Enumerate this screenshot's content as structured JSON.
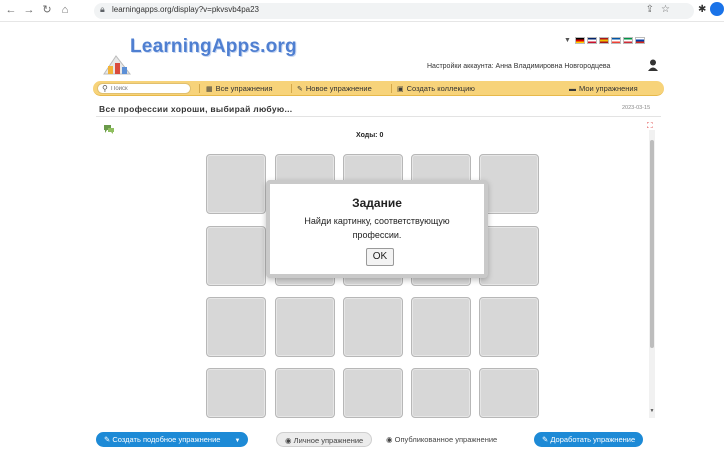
{
  "browser": {
    "url": "learningapps.org/display?v=pkvsvb4pa23"
  },
  "site": {
    "logo": "LearningApps.org",
    "account_label": "Настройки аккаунта: Анна Владимировна Новгородцева",
    "flags": [
      {
        "name": "flag-de",
        "colors": [
          "#000000",
          "#dd0000",
          "#ffce00"
        ]
      },
      {
        "name": "flag-uk",
        "colors": [
          "#012169",
          "#ffffff",
          "#c8102e"
        ]
      },
      {
        "name": "flag-es",
        "colors": [
          "#aa151b",
          "#f1bf00",
          "#aa151b"
        ]
      },
      {
        "name": "flag-fr",
        "colors": [
          "#0055a4",
          "#ffffff",
          "#ef4135"
        ]
      },
      {
        "name": "flag-it",
        "colors": [
          "#009246",
          "#ffffff",
          "#ce2b37"
        ]
      },
      {
        "name": "flag-ru",
        "colors": [
          "#ffffff",
          "#0039a6",
          "#d52b1e"
        ]
      }
    ]
  },
  "nav": {
    "search_placeholder": "Поиск",
    "all_exercises": "Все упражнения",
    "new_exercise": "Новое упражнение",
    "create_collection": "Создать коллекцию",
    "my_exercises": "Мои упражнения"
  },
  "exercise": {
    "title": "Все профессии хороши, выбирай любую...",
    "date": "2023-03-15",
    "moves": "Ходы: 0"
  },
  "dialog": {
    "title": "Задание",
    "text": "Найди картинку, соответствующую профессии.",
    "ok": "OK"
  },
  "bottom": {
    "create_similar": "Создать подобное упражнение",
    "private": "Личное упражнение",
    "published": "Опубликованное упражнение",
    "improve": "Доработать упражнение"
  },
  "colors": {
    "navbar": "#f7d37a",
    "logo": "#4f7fd1",
    "accent_blue": "#1d8ad6",
    "card": "#d7d7d7"
  }
}
